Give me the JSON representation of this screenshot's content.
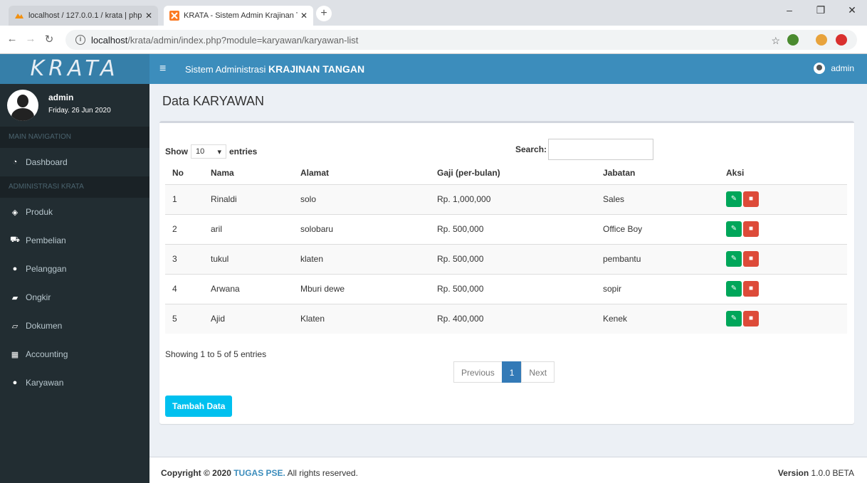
{
  "browser": {
    "tabs": [
      {
        "title": "localhost / 127.0.0.1 / krata | php",
        "close": "✕"
      },
      {
        "title": "KRATA - Sistem Admin Krajinan T",
        "close": "✕"
      }
    ],
    "new_tab": "+",
    "window_controls": [
      "–",
      "❐",
      "✕"
    ],
    "url_host": "localhost",
    "url_path": "/krata/admin/index.php?module=karyawan/karyawan-list"
  },
  "header": {
    "logo": "KRATA",
    "title_prefix": "Sistem Administrasi ",
    "title_bold": "KRAJINAN TANGAN",
    "user": "admin"
  },
  "sidebar": {
    "user_name": "admin",
    "date": "Friday. 26 Jun 2020",
    "main_nav_header": "MAIN NAVIGATION",
    "admin_header": "ADMINISTRASI KRATA",
    "dashboard": "Dashboard",
    "items": [
      "Produk",
      "Pembelian",
      "Pelanggan",
      "Ongkir",
      "Dokumen",
      "Accounting",
      "Karyawan"
    ]
  },
  "page": {
    "title": "Data KARYAWAN",
    "show_label": "Show",
    "length_value": "10",
    "entries_label": "entries",
    "search_label": "Search:",
    "columns": [
      "No",
      "Nama",
      "Alamat",
      "Gaji (per-bulan)",
      "Jabatan",
      "Aksi"
    ],
    "rows": [
      {
        "no": "1",
        "nama": "Rinaldi",
        "alamat": "solo",
        "gaji": "Rp. 1,000,000",
        "jabatan": "Sales"
      },
      {
        "no": "2",
        "nama": "aril",
        "alamat": "solobaru",
        "gaji": "Rp. 500,000",
        "jabatan": "Office Boy"
      },
      {
        "no": "3",
        "nama": "tukul",
        "alamat": "klaten",
        "gaji": "Rp. 500,000",
        "jabatan": "pembantu"
      },
      {
        "no": "4",
        "nama": "Arwana",
        "alamat": "Mburi dewe",
        "gaji": "Rp. 500,000",
        "jabatan": "sopir"
      },
      {
        "no": "5",
        "nama": "Ajid",
        "alamat": "Klaten",
        "gaji": "Rp. 400,000",
        "jabatan": "Kenek"
      }
    ],
    "info": "Showing 1 to 5 of 5 entries",
    "pagination": {
      "previous": "Previous",
      "current": "1",
      "next": "Next"
    },
    "add_button": "Tambah Data"
  },
  "footer": {
    "copyright": "Copyright © 2020 ",
    "brand": "TUGAS PSE.",
    "rights": " All rights reserved.",
    "version_label": "Version",
    "version": " 1.0.0 BETA"
  },
  "colors": {
    "header": "#3c8dbc",
    "logo_bg": "#367fa9",
    "sidebar": "#222d32",
    "edit_button": "#00a65a",
    "delete_button": "#dd4b39",
    "add_button": "#00c0ef"
  }
}
